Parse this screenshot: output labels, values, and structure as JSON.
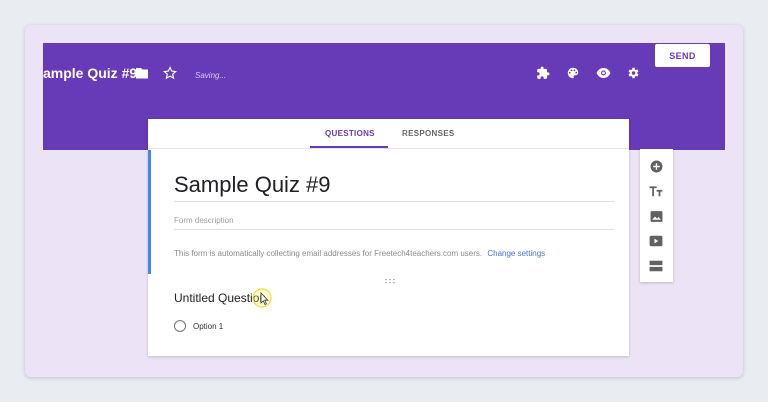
{
  "header": {
    "title": "ample Quiz #9",
    "status": "Saving...",
    "send_label": "SEND",
    "icons": [
      "folder-icon",
      "star-icon",
      "addon-icon",
      "palette-icon",
      "preview-icon",
      "settings-icon"
    ]
  },
  "tabs": [
    {
      "label": "QUESTIONS",
      "active": true
    },
    {
      "label": "RESPONSES",
      "active": false
    }
  ],
  "form": {
    "title": "Sample Quiz #9",
    "description_placeholder": "Form description",
    "notice": "This form is automatically collecting email addresses for Freetech4teachers.com users.",
    "change_settings": "Change settings"
  },
  "question": {
    "title": "Untitled Question",
    "options": [
      "Option 1"
    ]
  },
  "toolbar": {
    "icons": [
      "add-question-icon",
      "add-title-icon",
      "add-image-icon",
      "add-video-icon",
      "add-section-icon"
    ]
  },
  "colors": {
    "brand": "#673ab7",
    "background": "#ede3f7",
    "accent_bar": "#4285f4",
    "link": "#4a6fd6"
  }
}
